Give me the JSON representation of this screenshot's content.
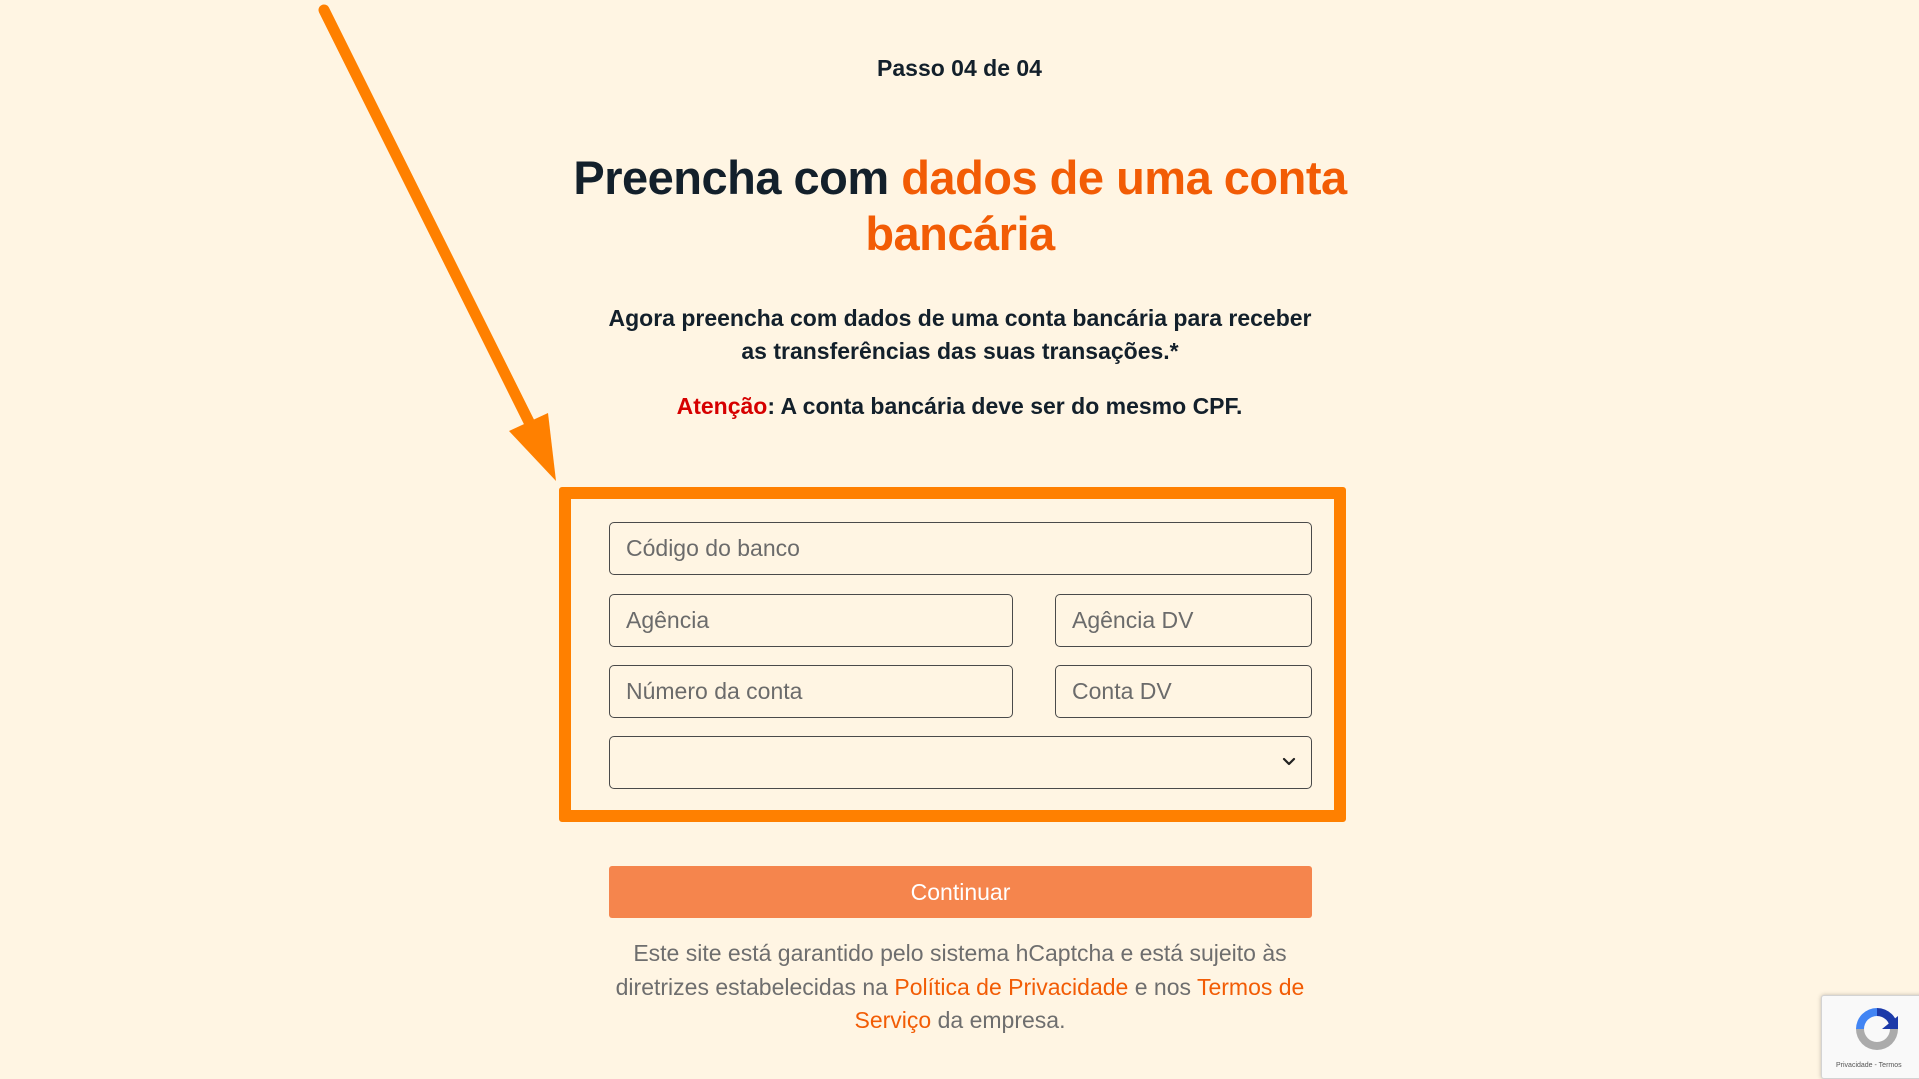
{
  "step": "Passo 04 de 04",
  "title": {
    "part1": "Preencha com ",
    "accent": "dados de uma conta bancária"
  },
  "subtitle": "Agora preencha com dados de uma conta bancária para receber as transferências das suas transações.*",
  "attention": {
    "label": "Atenção",
    "text": ": A conta bancária deve ser do mesmo CPF."
  },
  "form": {
    "bank_code_placeholder": "Código do banco",
    "agency_placeholder": "Agência",
    "agency_dv_placeholder": "Agência DV",
    "account_number_placeholder": "Número da conta",
    "account_dv_placeholder": "Conta DV",
    "account_type_value": ""
  },
  "continue_label": "Continuar",
  "legal": {
    "text1": "Este site está garantido pelo sistema hCaptcha e está sujeito às diretrizes estabelecidas na ",
    "privacy_link": "Política de Privacidade",
    "text2": " e nos ",
    "terms_link": "Termos de Serviço",
    "text3": " da empresa."
  },
  "recaptcha": {
    "terms": "Privacidade - Termos"
  },
  "colors": {
    "background": "#fff5e3",
    "accent": "#f25c05",
    "highlight_frame": "#ff8000",
    "warning": "#d60000",
    "button": "#f5854d"
  }
}
